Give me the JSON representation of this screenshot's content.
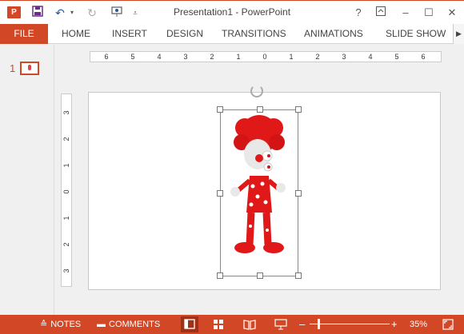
{
  "app": {
    "title": "Presentation1 - PowerPoint",
    "icon_letter": "P",
    "brand_color": "#d24726"
  },
  "quick_access": {
    "save_icon": "save-icon",
    "undo_icon": "undo-icon",
    "redo_icon": "redo-icon",
    "present_icon": "present-icon",
    "customize_icon": "chevron-down-icon"
  },
  "window": {
    "help": "?",
    "restore_ribbon_icon": "ribbon-display-icon",
    "minimize": "–",
    "maximize": "☐",
    "close": "✕"
  },
  "ribbon": {
    "file_label": "FILE",
    "tabs": [
      "HOME",
      "INSERT",
      "DESIGN",
      "TRANSITIONS",
      "ANIMATIONS",
      "SLIDE SHOW"
    ],
    "scroll_icon": "chevron-right-icon"
  },
  "slides_pane": {
    "slide_number": "1"
  },
  "rulers": {
    "horizontal": [
      "6",
      "5",
      "4",
      "3",
      "2",
      "1",
      "0",
      "1",
      "2",
      "3",
      "4",
      "5",
      "6"
    ],
    "vertical": [
      "3",
      "2",
      "1",
      "0",
      "1",
      "2",
      "3"
    ]
  },
  "slide": {
    "image_name": "clown-3d-figure",
    "selected": true
  },
  "status_bar": {
    "notes_label": "NOTES",
    "comments_label": "COMMENTS",
    "zoom_minus": "–",
    "zoom_plus": "+",
    "zoom_level": "35%",
    "zoom_fraction": 0.35
  }
}
